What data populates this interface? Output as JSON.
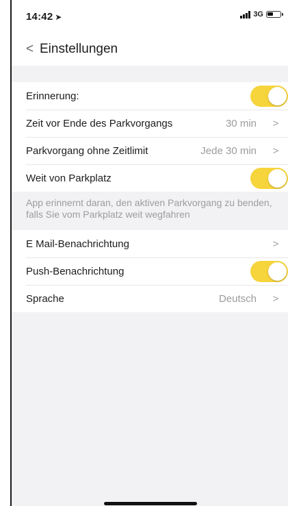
{
  "status_bar": {
    "time": "14:42",
    "location_icon": "location-arrow-icon",
    "signal_icon": "signal-bars-icon",
    "network": "3G",
    "battery_icon": "battery-icon"
  },
  "nav": {
    "back_icon": "chevron-left-icon",
    "back_glyph": "<",
    "title": "Einstellungen"
  },
  "settings": {
    "reminder": {
      "label": "Erinnerung:",
      "toggle_on": true
    },
    "time_before_end": {
      "label": "Zeit vor Ende des Parkvorgangs",
      "value": "30 min",
      "chevron": ">"
    },
    "no_time_limit": {
      "label": "Parkvorgang ohne Zeitlimit",
      "value": "Jede 30 min",
      "chevron": ">"
    },
    "far_from_parking": {
      "label": "Weit von Parkplatz",
      "toggle_on": true
    },
    "info": "App erinnernt daran, den aktiven Parkvorgang zu benden, falls Sie vom Parkplatz weit wegfahren",
    "email_notification": {
      "label": "E Mail-Benachrichtung",
      "chevron": ">"
    },
    "push_notification": {
      "label": "Push-Benachrichtung",
      "toggle_on": true
    },
    "language": {
      "label": "Sprache",
      "value": "Deutsch",
      "chevron": ">"
    }
  },
  "colors": {
    "toggle_on": "#f6d43c",
    "background": "#f2f2f4",
    "secondary_text": "#9b9b9b"
  }
}
